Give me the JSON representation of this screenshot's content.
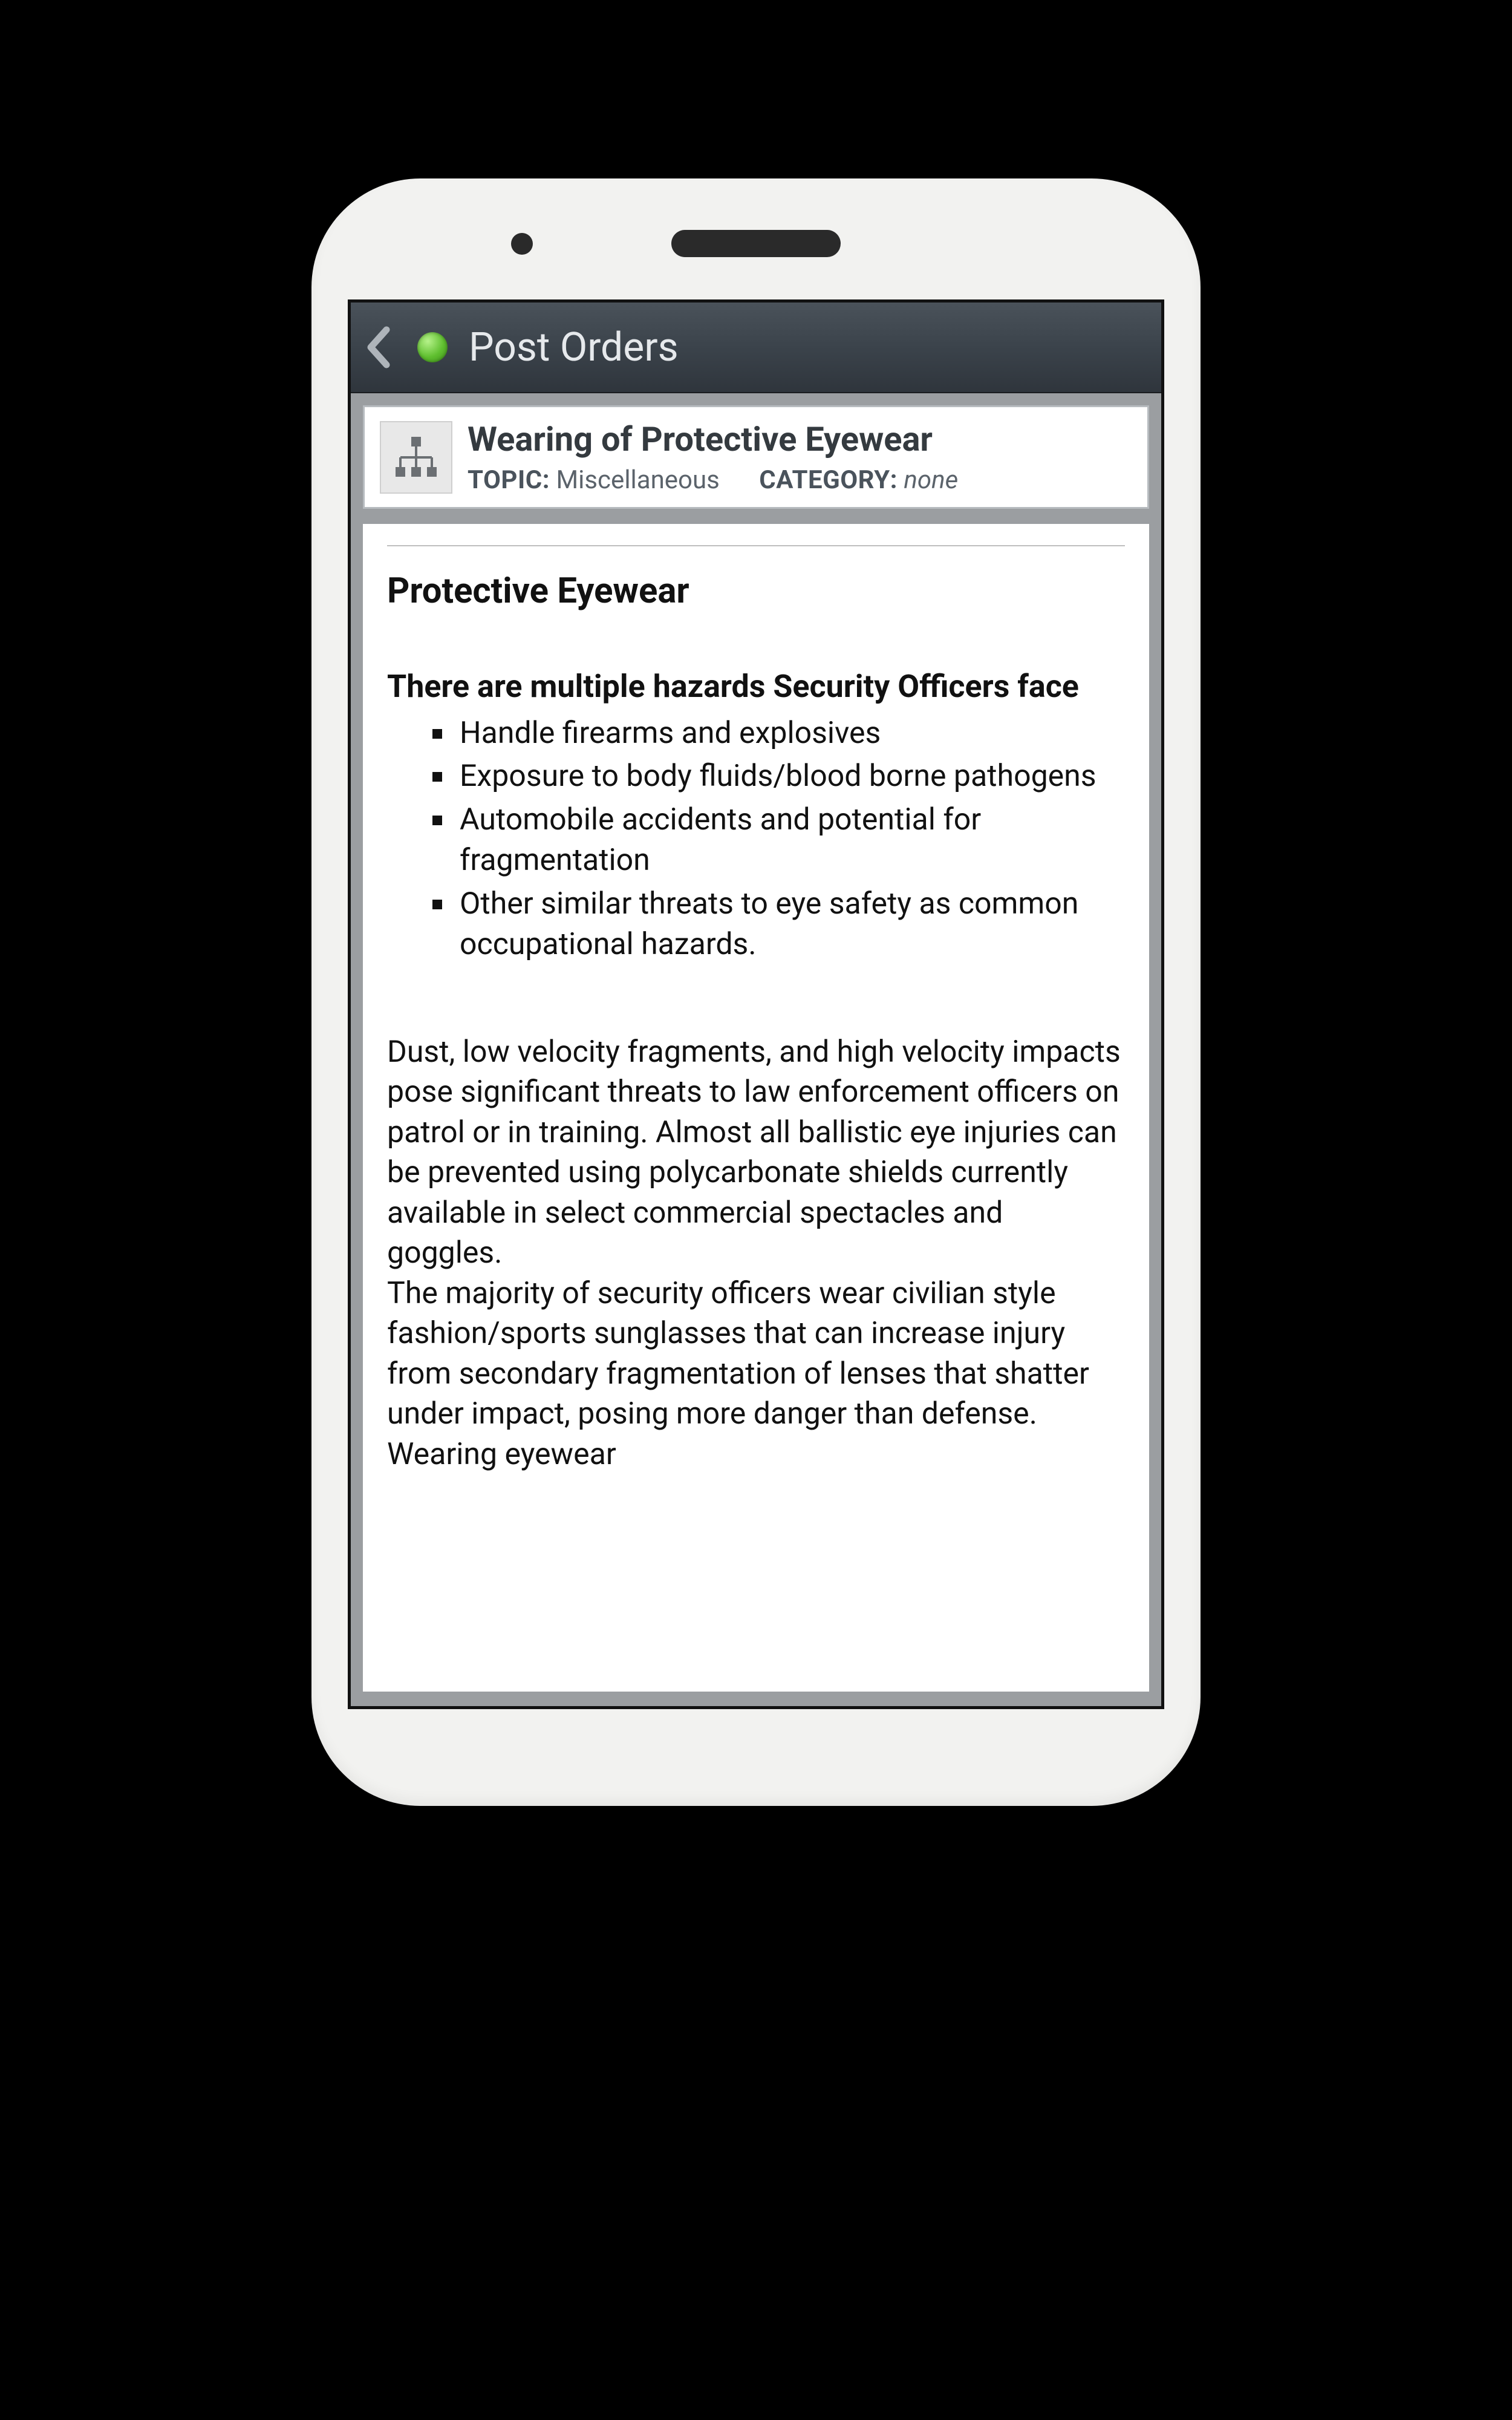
{
  "header": {
    "title": "Post Orders"
  },
  "card": {
    "title": "Wearing of Protective Eyewear",
    "topic_label": "TOPIC:",
    "topic_value": "Miscellaneous",
    "category_label": "CATEGORY:",
    "category_value": "none"
  },
  "article": {
    "heading": "Protective Eyewear",
    "subheading": "There are multiple hazards Security Officers face",
    "bullets": [
      "Handle firearms and explosives",
      "Exposure to body fluids/blood borne pathogens",
      "Automobile accidents and potential for fragmentation",
      "Other similar threats to eye safety as common occupational hazards."
    ],
    "para1": "Dust, low velocity fragments, and high velocity impacts pose significant threats to law enforcement officers on patrol or in training. Almost all ballistic eye injuries can be prevented using polycarbonate shields currently available in select commercial spectacles and goggles.",
    "para2": "The majority of security officers wear civilian style fashion/sports sunglasses that can increase injury from secondary fragmentation of lenses that shatter under impact, posing more danger than defense. Wearing eyewear"
  }
}
